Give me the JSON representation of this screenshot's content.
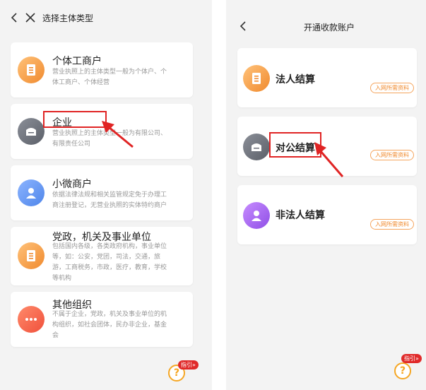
{
  "left_screen": {
    "title": "选择主体类型",
    "entity_types": [
      {
        "name": "个体工商户",
        "desc_lines": [
          "营业执照上的主体类型一般为个体户、个",
          "体工商户、个体经营"
        ],
        "icon": "document-icon"
      },
      {
        "name": "企业",
        "desc_lines": [
          "营业执照上的主体类型一般为有限公司、",
          "有限责任公司"
        ],
        "icon": "building-icon"
      },
      {
        "name": "小微商户",
        "desc_lines": [
          "依据法律法规和相关监管规定免于办理工",
          "商注册登记，无营业执照的实体特约商户"
        ],
        "icon": "person-icon"
      },
      {
        "name": "党政，机关及事业单位",
        "desc_lines": [
          "包括国内各级，各类政府机构，事业单位",
          "等，如：公安，党团，司法，交通，旅",
          "游，工商税务，市政，医疗，教育，学校",
          "等机构"
        ],
        "icon": "document-icon"
      },
      {
        "name": "其他组织",
        "desc_lines": [
          "不属于企业，党政，机关及事业单位的机",
          "构组织，如社会团体，民办非企业，基金",
          "会"
        ],
        "icon": "more-icon"
      }
    ],
    "help": {
      "badge": "指引»",
      "symbol": "?"
    }
  },
  "right_screen": {
    "title": "开通收款账户",
    "settle_types": [
      {
        "name": "法人结算",
        "tag": "入网所需资料",
        "icon": "document-icon"
      },
      {
        "name": "对公结算",
        "tag": "入网所需资料",
        "icon": "building-icon"
      },
      {
        "name": "非法人结算",
        "tag": "入网所需资料",
        "icon": "person-icon"
      }
    ],
    "help": {
      "badge": "指引»",
      "symbol": "?"
    }
  },
  "colors": {
    "accent": "#f08a2e",
    "highlight": "#e02424",
    "background": "#f3f3f3"
  }
}
